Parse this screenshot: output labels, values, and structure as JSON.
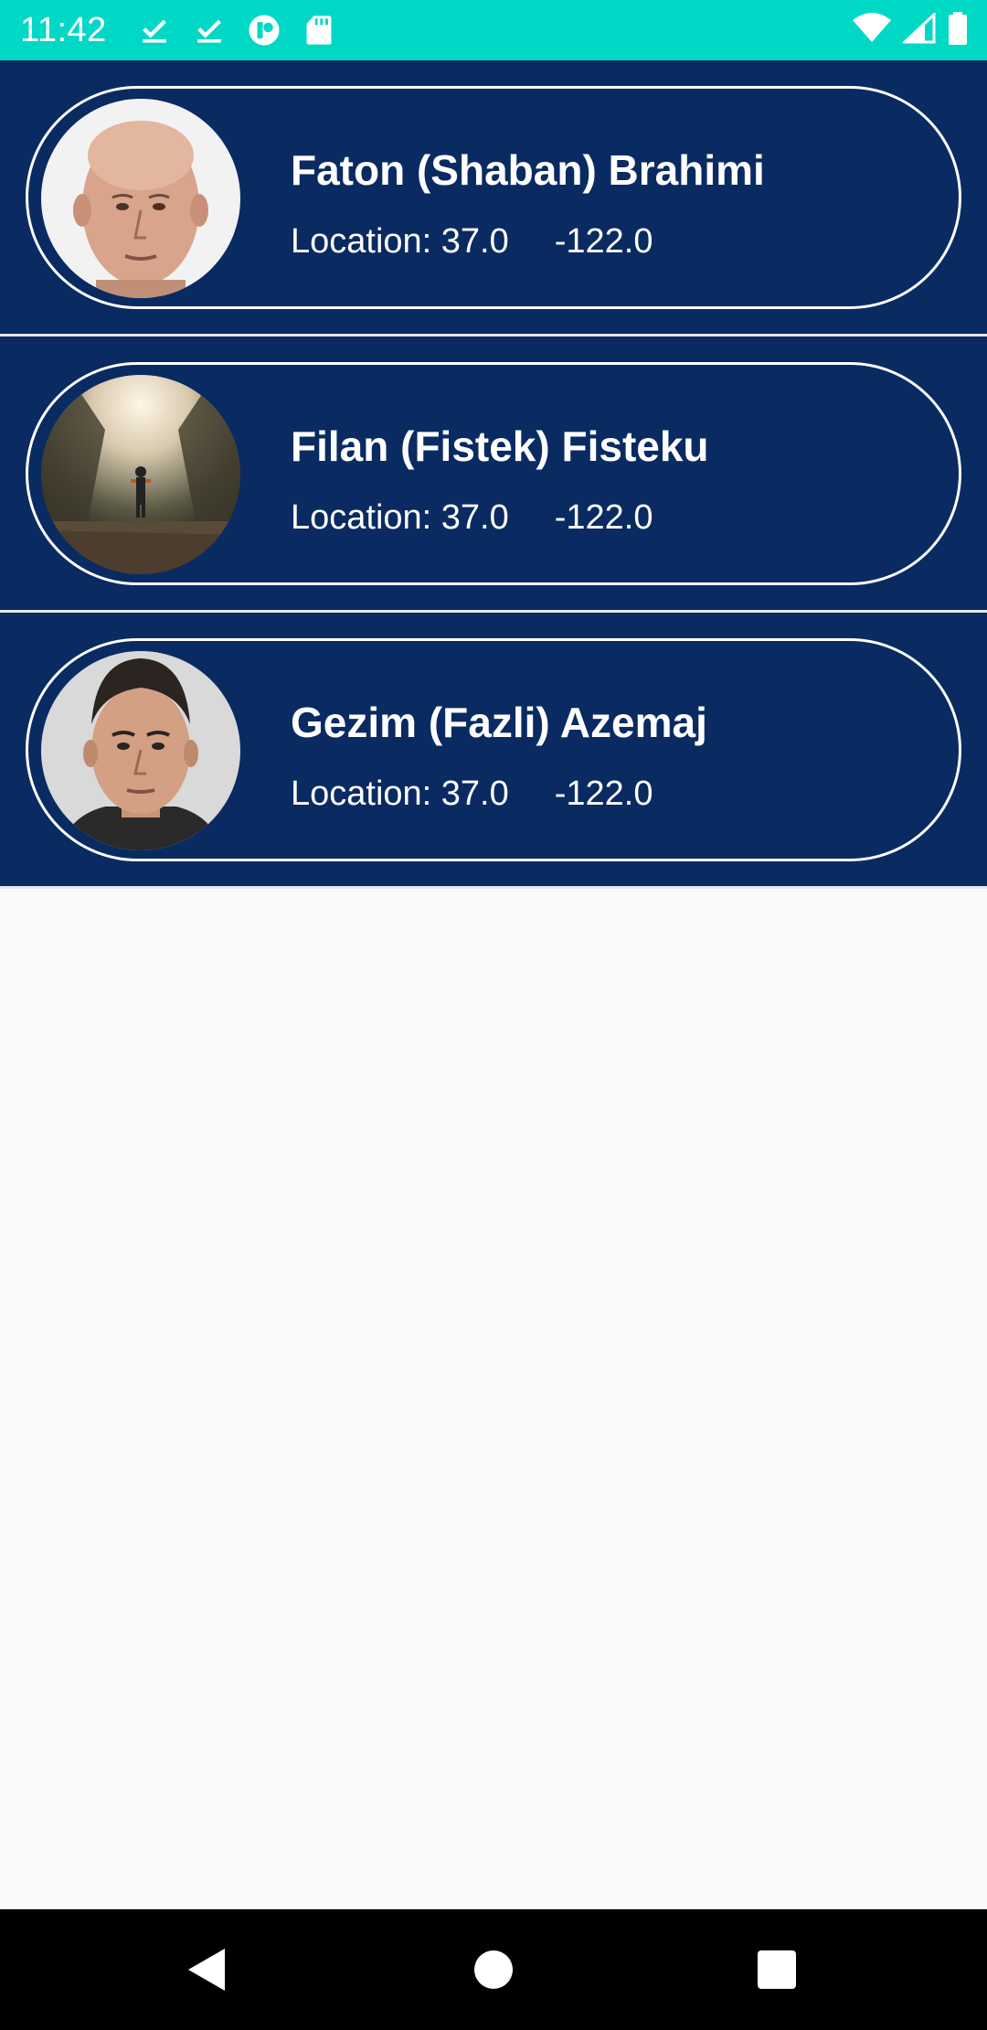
{
  "status_bar": {
    "time": "11:42",
    "left_icons": [
      "download-done-icon",
      "download-done-icon",
      "app-notification-icon",
      "sd-card-icon"
    ],
    "right_icons": [
      "wifi-icon",
      "cellular-signal-icon",
      "battery-icon"
    ],
    "color": "#00d8c6"
  },
  "people": [
    {
      "name": "Faton (Shaban) Brahimi",
      "location_label": "Location: 37.0",
      "longitude": "-122.0",
      "avatar": "bald-man-portrait"
    },
    {
      "name": "Filan (Fistek) Fisteku",
      "location_label": "Location: 37.0",
      "longitude": "-122.0",
      "avatar": "figure-in-forest-road"
    },
    {
      "name": "Gezim (Fazli) Azemaj",
      "location_label": "Location: 37.0",
      "longitude": "-122.0",
      "avatar": "dark-haired-man-portrait"
    }
  ],
  "colors": {
    "list_background": "#0a2a62",
    "card_border": "#ffffff",
    "page_background": "#fafafa"
  },
  "nav_bar": {
    "buttons": [
      "back-icon",
      "home-icon",
      "recents-icon"
    ]
  }
}
